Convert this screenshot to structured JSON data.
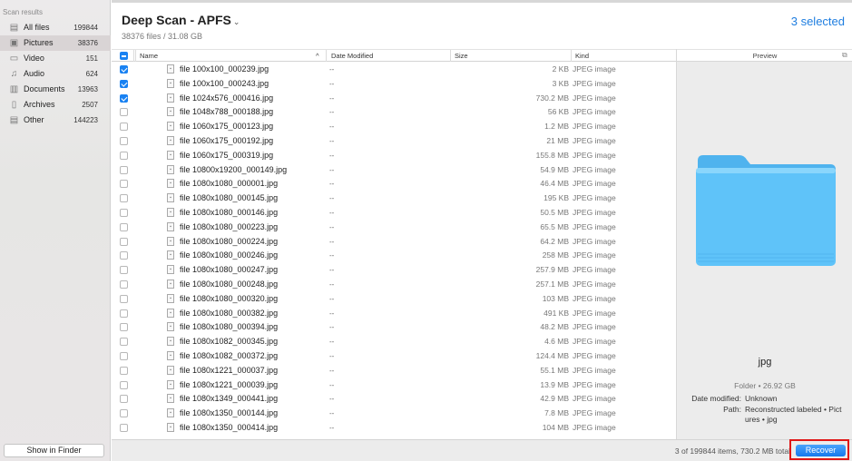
{
  "sidebar": {
    "title": "Scan results",
    "items": [
      {
        "label": "All files",
        "count": "199844",
        "icon": "all-files-icon"
      },
      {
        "label": "Pictures",
        "count": "38376",
        "icon": "pictures-icon",
        "selected": true
      },
      {
        "label": "Video",
        "count": "151",
        "icon": "video-icon"
      },
      {
        "label": "Audio",
        "count": "624",
        "icon": "audio-icon"
      },
      {
        "label": "Documents",
        "count": "13963",
        "icon": "documents-icon"
      },
      {
        "label": "Archives",
        "count": "2507",
        "icon": "archives-icon"
      },
      {
        "label": "Other",
        "count": "144223",
        "icon": "other-icon"
      }
    ],
    "show_in_finder": "Show in Finder"
  },
  "header": {
    "title": "Deep Scan - APFS",
    "subtitle": "38376 files / 31.08 GB",
    "selected": "3 selected"
  },
  "table": {
    "columns": {
      "name": "Name",
      "date": "Date Modified",
      "size": "Size",
      "kind": "Kind"
    },
    "rows": [
      {
        "name": "file 100x100_000239.jpg",
        "date": "--",
        "size": "2 KB",
        "kind": "JPEG image",
        "checked": true
      },
      {
        "name": "file 100x100_000243.jpg",
        "date": "--",
        "size": "3 KB",
        "kind": "JPEG image",
        "checked": true
      },
      {
        "name": "file 1024x576_000416.jpg",
        "date": "--",
        "size": "730.2 MB",
        "kind": "JPEG image",
        "checked": true
      },
      {
        "name": "file 1048x788_000188.jpg",
        "date": "--",
        "size": "56 KB",
        "kind": "JPEG image",
        "checked": false
      },
      {
        "name": "file 1060x175_000123.jpg",
        "date": "--",
        "size": "1.2 MB",
        "kind": "JPEG image",
        "checked": false
      },
      {
        "name": "file 1060x175_000192.jpg",
        "date": "--",
        "size": "21 MB",
        "kind": "JPEG image",
        "checked": false
      },
      {
        "name": "file 1060x175_000319.jpg",
        "date": "--",
        "size": "155.8 MB",
        "kind": "JPEG image",
        "checked": false
      },
      {
        "name": "file 10800x19200_000149.jpg",
        "date": "--",
        "size": "54.9 MB",
        "kind": "JPEG image",
        "checked": false
      },
      {
        "name": "file 1080x1080_000001.jpg",
        "date": "--",
        "size": "46.4 MB",
        "kind": "JPEG image",
        "checked": false
      },
      {
        "name": "file 1080x1080_000145.jpg",
        "date": "--",
        "size": "195 KB",
        "kind": "JPEG image",
        "checked": false
      },
      {
        "name": "file 1080x1080_000146.jpg",
        "date": "--",
        "size": "50.5 MB",
        "kind": "JPEG image",
        "checked": false
      },
      {
        "name": "file 1080x1080_000223.jpg",
        "date": "--",
        "size": "65.5 MB",
        "kind": "JPEG image",
        "checked": false
      },
      {
        "name": "file 1080x1080_000224.jpg",
        "date": "--",
        "size": "64.2 MB",
        "kind": "JPEG image",
        "checked": false
      },
      {
        "name": "file 1080x1080_000246.jpg",
        "date": "--",
        "size": "258 MB",
        "kind": "JPEG image",
        "checked": false
      },
      {
        "name": "file 1080x1080_000247.jpg",
        "date": "--",
        "size": "257.9 MB",
        "kind": "JPEG image",
        "checked": false
      },
      {
        "name": "file 1080x1080_000248.jpg",
        "date": "--",
        "size": "257.1 MB",
        "kind": "JPEG image",
        "checked": false
      },
      {
        "name": "file 1080x1080_000320.jpg",
        "date": "--",
        "size": "103 MB",
        "kind": "JPEG image",
        "checked": false
      },
      {
        "name": "file 1080x1080_000382.jpg",
        "date": "--",
        "size": "491 KB",
        "kind": "JPEG image",
        "checked": false
      },
      {
        "name": "file 1080x1080_000394.jpg",
        "date": "--",
        "size": "48.2 MB",
        "kind": "JPEG image",
        "checked": false
      },
      {
        "name": "file 1080x1082_000345.jpg",
        "date": "--",
        "size": "4.6 MB",
        "kind": "JPEG image",
        "checked": false
      },
      {
        "name": "file 1080x1082_000372.jpg",
        "date": "--",
        "size": "124.4 MB",
        "kind": "JPEG image",
        "checked": false
      },
      {
        "name": "file 1080x1221_000037.jpg",
        "date": "--",
        "size": "55.1 MB",
        "kind": "JPEG image",
        "checked": false
      },
      {
        "name": "file 1080x1221_000039.jpg",
        "date": "--",
        "size": "13.9 MB",
        "kind": "JPEG image",
        "checked": false
      },
      {
        "name": "file 1080x1349_000441.jpg",
        "date": "--",
        "size": "42.9 MB",
        "kind": "JPEG image",
        "checked": false
      },
      {
        "name": "file 1080x1350_000144.jpg",
        "date": "--",
        "size": "7.8 MB",
        "kind": "JPEG image",
        "checked": false
      },
      {
        "name": "file 1080x1350_000414.jpg",
        "date": "--",
        "size": "104 MB",
        "kind": "JPEG image",
        "checked": false
      }
    ]
  },
  "preview": {
    "title": "Preview",
    "name": "jpg",
    "meta": "Folder • 26.92 GB",
    "date_key": "Date modified:",
    "date_val": "Unknown",
    "path_key": "Path:",
    "path_val_1": "Reconstructed labeled • Pict",
    "path_val_2": "ures • jpg",
    "folder_color": "#5fc3f9"
  },
  "footer": {
    "status": "3 of 199844 items, 730.2 MB total",
    "recover": "Recover"
  },
  "colors": {
    "accent": "#1a82f2",
    "highlight_border": "#e01616"
  }
}
